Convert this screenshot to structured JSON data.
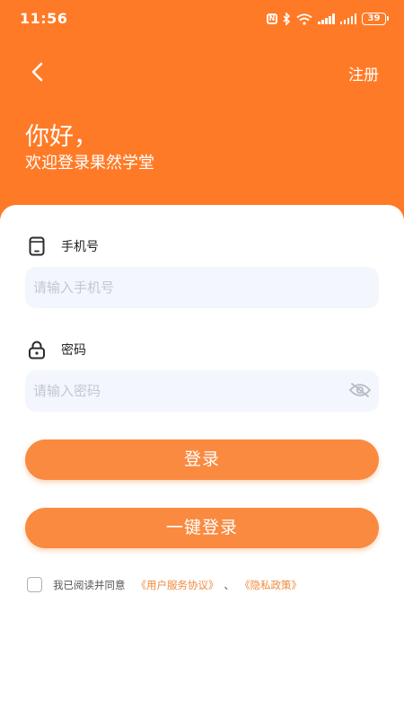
{
  "status_bar": {
    "time": "11:56",
    "battery": "39"
  },
  "header": {
    "back_icon": "chevron-left-icon",
    "register_label": "注册",
    "greeting_title": "你好，",
    "greeting_subtitle": "欢迎登录果然学堂",
    "background_color": "#ff7a26"
  },
  "form": {
    "phone": {
      "label": "手机号",
      "icon": "phone-icon",
      "placeholder": "请输入手机号",
      "value": ""
    },
    "password": {
      "label": "密码",
      "icon": "lock-icon",
      "placeholder": "请输入密码",
      "value": "",
      "visibility_icon": "eye-off-icon"
    }
  },
  "buttons": {
    "login_label": "登录",
    "one_click_login_label": "一键登录",
    "color": "#f98a40"
  },
  "agreement": {
    "checked": false,
    "prefix": "我已阅读并同意",
    "user_agreement": "《用户服务协议》",
    "separator": "、",
    "privacy_policy": "《隐私政策》",
    "link_color": "#f08a3c"
  }
}
